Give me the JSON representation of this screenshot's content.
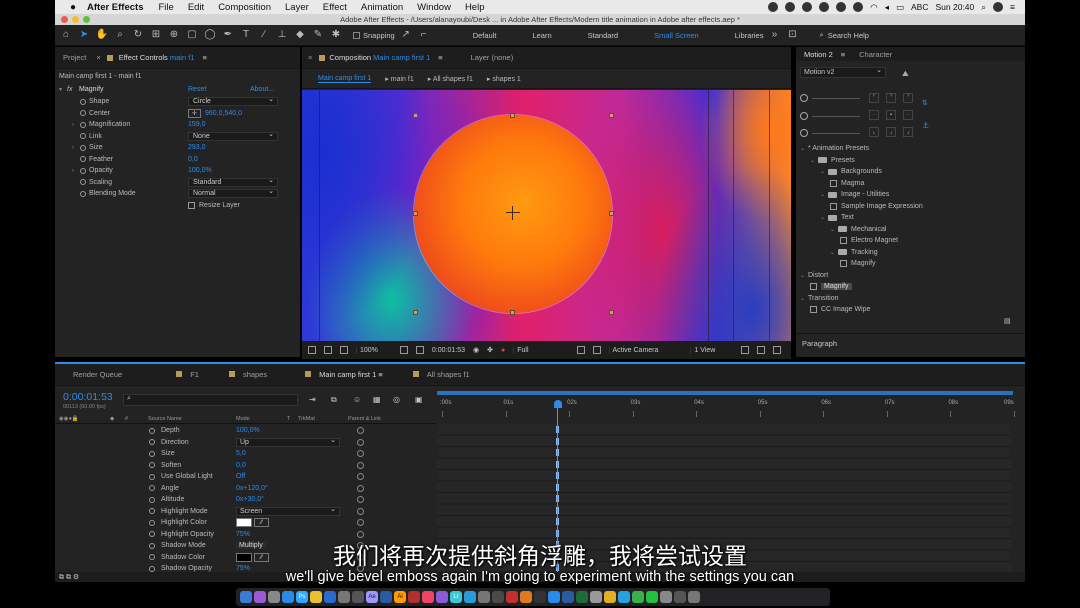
{
  "menubar": {
    "apple": "",
    "app_name": "After Effects",
    "menus": [
      "File",
      "Edit",
      "Composition",
      "Layer",
      "Effect",
      "Animation",
      "Window",
      "Help"
    ],
    "input_label": "ABC",
    "clock": "Sun 20:40"
  },
  "window": {
    "title": "Adobe After Effects - /Users/alanayoubi/Desk ... in Adobe After Effects/Modern title animation in Adobe after effects.aep *"
  },
  "toolbar": {
    "snapping_label": "Snapping",
    "workspaces": [
      "Default",
      "Learn",
      "Standard",
      "Small Screen",
      "Libraries"
    ],
    "active_workspace": "Small Screen",
    "search_placeholder": "Search Help"
  },
  "effect_controls": {
    "tab_project": "Project",
    "tab_ec_prefix": "Effect Controls",
    "tab_ec_layer": "main f1",
    "subtitle": "Main camp first 1 - main f1",
    "effect_name": "Magnify",
    "reset_label": "Reset",
    "about_label": "About...",
    "properties": [
      {
        "label": "Shape",
        "value": "Circle",
        "kind": "dropdown"
      },
      {
        "label": "Center",
        "value": "960,0,540,0",
        "kind": "point"
      },
      {
        "label": "Magnification",
        "value": "159,0",
        "kind": "value"
      },
      {
        "label": "Link",
        "value": "None",
        "kind": "dropdown"
      },
      {
        "label": "Size",
        "value": "293,0",
        "kind": "value"
      },
      {
        "label": "Feather",
        "value": "0,0",
        "kind": "value"
      },
      {
        "label": "Opacity",
        "value": "100,0%",
        "kind": "value"
      },
      {
        "label": "Scaling",
        "value": "Standard",
        "kind": "dropdown"
      },
      {
        "label": "Blending Mode",
        "value": "Normal",
        "kind": "dropdown"
      },
      {
        "label": "",
        "value": "Resize Layer",
        "kind": "checkbox"
      }
    ]
  },
  "composition": {
    "tab_prefix": "Composition",
    "tab_name": "Main camp first 1",
    "layer_tab": "Layer (none)",
    "breadcrumbs": [
      "Main camp first 1",
      "main f1",
      "All shapes f1",
      "shapes 1"
    ],
    "zoom": "100%",
    "timecode": "0:00:01:53",
    "resolution": "Full",
    "camera": "Active Camera",
    "view": "1 View"
  },
  "motion_panel": {
    "tab_motion": "Motion 2",
    "tab_character": "Character",
    "preset": "Motion v2",
    "paragraph_label": "Paragraph"
  },
  "effects_presets": {
    "rows": [
      {
        "label": "* Animation Presets",
        "level": 0,
        "type": "root"
      },
      {
        "label": "Presets",
        "level": 1,
        "type": "folder"
      },
      {
        "label": "Backgrounds",
        "level": 2,
        "type": "folder"
      },
      {
        "label": "Magma",
        "level": 3,
        "type": "preset"
      },
      {
        "label": "Image - Utilities",
        "level": 2,
        "type": "folder"
      },
      {
        "label": "Sample Image Expression",
        "level": 3,
        "type": "preset"
      },
      {
        "label": "Text",
        "level": 2,
        "type": "folder"
      },
      {
        "label": "Mechanical",
        "level": 3,
        "type": "folder"
      },
      {
        "label": "Electro Magnet",
        "level": 4,
        "type": "preset"
      },
      {
        "label": "Tracking",
        "level": 3,
        "type": "folder"
      },
      {
        "label": "Magnify",
        "level": 4,
        "type": "preset"
      },
      {
        "label": "Distort",
        "level": 0,
        "type": "category"
      },
      {
        "label": "Magnify",
        "level": 1,
        "type": "preset",
        "highlight": true
      },
      {
        "label": "Transition",
        "level": 0,
        "type": "category"
      },
      {
        "label": "CC Image Wipe",
        "level": 1,
        "type": "preset"
      }
    ]
  },
  "timeline": {
    "tabs": [
      "Render Queue",
      "F1",
      "shapes",
      "Main camp first 1",
      "All shapes f1"
    ],
    "active_tab": "Main camp first 1",
    "timecode": "0:00:01:53",
    "fps": "00113 (60.00 fps)",
    "search_icon": "⌕",
    "col_source": "Source Name",
    "col_mode": "Mode",
    "col_t": "T",
    "col_trkmat": "TrkMat",
    "col_parent": "Parent & Link",
    "ruler_ticks": [
      ":00s",
      "01s",
      "02s",
      "03s",
      "04s",
      "05s",
      "06s",
      "07s",
      "08s",
      "09s"
    ],
    "playhead_seconds": 1.88,
    "duration_seconds": 9,
    "properties": [
      {
        "label": "Depth",
        "value": "100,0%",
        "kind": "value"
      },
      {
        "label": "Direction",
        "value": "Up",
        "kind": "dropdown"
      },
      {
        "label": "Size",
        "value": "5,0",
        "kind": "value"
      },
      {
        "label": "Soften",
        "value": "0,0",
        "kind": "value"
      },
      {
        "label": "Use Global Light",
        "value": "Off",
        "kind": "value"
      },
      {
        "label": "Angle",
        "value": "0x+120,0°",
        "kind": "value"
      },
      {
        "label": "Altitude",
        "value": "0x+30,0°",
        "kind": "value"
      },
      {
        "label": "Highlight Mode",
        "value": "Screen",
        "kind": "dropdown"
      },
      {
        "label": "Highlight Color",
        "value": "",
        "kind": "color",
        "color": "#ffffff"
      },
      {
        "label": "Highlight Opacity",
        "value": "75%",
        "kind": "value"
      },
      {
        "label": "Shadow Mode",
        "value": "Multiply",
        "kind": "dropdown"
      },
      {
        "label": "Shadow Color",
        "value": "",
        "kind": "color",
        "color": "#000000"
      },
      {
        "label": "Shadow Opacity",
        "value": "75%",
        "kind": "value"
      }
    ]
  },
  "subtitles": {
    "chinese": "我们将再次提供斜角浮雕，我将尝试设置",
    "english": "we'll give bevel emboss again I'm going to experiment with the settings you can"
  },
  "colors": {
    "accent": "#2d8ceb",
    "panel": "#232323",
    "label_swatch": "#b59a5a"
  }
}
